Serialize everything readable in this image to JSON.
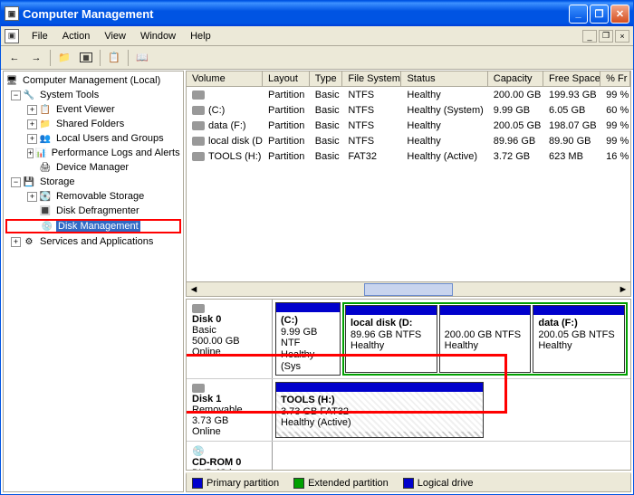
{
  "window": {
    "title": "Computer Management"
  },
  "menu": {
    "file": "File",
    "action": "Action",
    "view": "View",
    "window": "Window",
    "help": "Help"
  },
  "tree": {
    "root": "Computer Management (Local)",
    "system_tools": "System Tools",
    "event_viewer": "Event Viewer",
    "shared_folders": "Shared Folders",
    "local_users": "Local Users and Groups",
    "perf_logs": "Performance Logs and Alerts",
    "device_manager": "Device Manager",
    "storage": "Storage",
    "removable_storage": "Removable Storage",
    "disk_defrag": "Disk Defragmenter",
    "disk_mgmt": "Disk Management",
    "services": "Services and Applications"
  },
  "columns": {
    "volume": "Volume",
    "layout": "Layout",
    "type": "Type",
    "fs": "File System",
    "status": "Status",
    "capacity": "Capacity",
    "free": "Free Space",
    "pct": "% Fr"
  },
  "volumes": [
    {
      "name": "",
      "layout": "Partition",
      "type": "Basic",
      "fs": "NTFS",
      "status": "Healthy",
      "capacity": "200.00 GB",
      "free": "199.93 GB",
      "pct": "99 %"
    },
    {
      "name": "(C:)",
      "layout": "Partition",
      "type": "Basic",
      "fs": "NTFS",
      "status": "Healthy (System)",
      "capacity": "9.99 GB",
      "free": "6.05 GB",
      "pct": "60 %"
    },
    {
      "name": "data (F:)",
      "layout": "Partition",
      "type": "Basic",
      "fs": "NTFS",
      "status": "Healthy",
      "capacity": "200.05 GB",
      "free": "198.07 GB",
      "pct": "99 %"
    },
    {
      "name": "local disk (D:)",
      "layout": "Partition",
      "type": "Basic",
      "fs": "NTFS",
      "status": "Healthy",
      "capacity": "89.96 GB",
      "free": "89.90 GB",
      "pct": "99 %"
    },
    {
      "name": "TOOLS (H:)",
      "layout": "Partition",
      "type": "Basic",
      "fs": "FAT32",
      "status": "Healthy (Active)",
      "capacity": "3.72 GB",
      "free": "623 MB",
      "pct": "16 %"
    }
  ],
  "disks": {
    "disk0": {
      "name": "Disk 0",
      "type": "Basic",
      "size": "500.00 GB",
      "status": "Online"
    },
    "disk1": {
      "name": "Disk 1",
      "type": "Removable",
      "size": "3.73 GB",
      "status": "Online"
    },
    "cdrom": {
      "name": "CD-ROM 0",
      "type": "DVD (G:)"
    }
  },
  "partitions": {
    "c": {
      "label": "(C:)",
      "info": "9.99 GB NTF",
      "status": "Healthy (Sys"
    },
    "d": {
      "label": "local disk  (D:",
      "info": "89.96 GB NTFS",
      "status": "Healthy"
    },
    "unnamed": {
      "label": "",
      "info": "200.00 GB NTFS",
      "status": "Healthy"
    },
    "f": {
      "label": "data  (F:)",
      "info": "200.05 GB NTFS",
      "status": "Healthy"
    },
    "h": {
      "label": "TOOLS  (H:)",
      "info": "3.73 GB FAT32",
      "status": "Healthy (Active)"
    }
  },
  "legend": {
    "primary": "Primary partition",
    "extended": "Extended partition",
    "logical": "Logical drive"
  }
}
